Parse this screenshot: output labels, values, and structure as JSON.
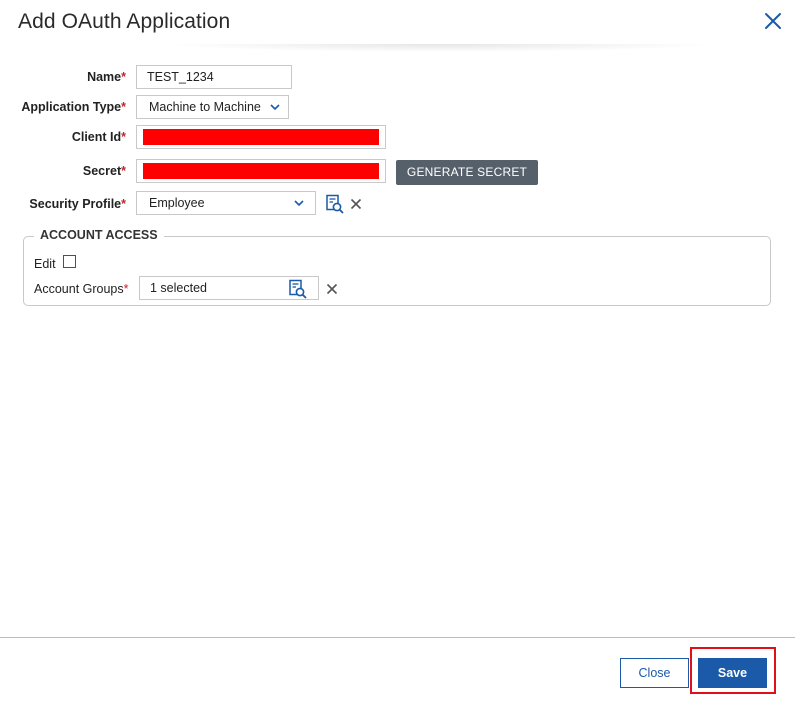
{
  "dialog": {
    "title": "Add OAuth Application"
  },
  "form": {
    "name": {
      "label": "Name",
      "required_mark": "*",
      "value": "TEST_1234"
    },
    "application_type": {
      "label": "Application Type",
      "required_mark": "*",
      "value": "Machine to Machine"
    },
    "client_id": {
      "label": "Client Id",
      "required_mark": "*",
      "redaction_color": "#ff0000"
    },
    "secret": {
      "label": "Secret",
      "required_mark": "*",
      "redaction_color": "#ff0000",
      "generate_label": "GENERATE SECRET"
    },
    "security_profile": {
      "label": "Security Profile",
      "required_mark": "*",
      "value": "Employee"
    }
  },
  "account_access": {
    "legend": "ACCOUNT ACCESS",
    "edit_label": "Edit",
    "edit_checked": false,
    "account_groups": {
      "label": "Account Groups",
      "required_mark": "*",
      "value": "1 selected"
    }
  },
  "footer": {
    "close_label": "Close",
    "save_label": "Save"
  },
  "icons": {
    "dialog_close": "close-icon",
    "lookup": "search-list-icon",
    "clear": "clear-icon",
    "dropdown": "chevron-down-icon"
  },
  "colors": {
    "primary": "#1a5aa8",
    "required": "#c0262d",
    "secondary_button": "#56606b",
    "highlight_border": "#e0101a"
  }
}
